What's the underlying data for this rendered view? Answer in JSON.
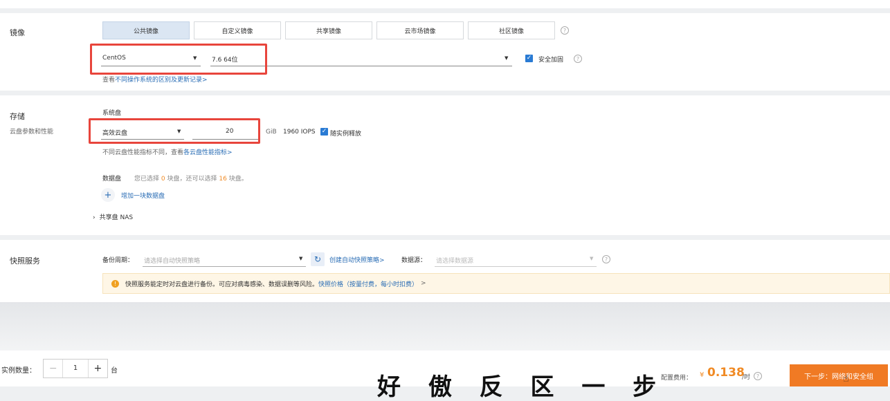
{
  "image": {
    "label": "镜像",
    "tabs": [
      "公共镜像",
      "自定义镜像",
      "共享镜像",
      "云市场镜像",
      "社区镜像"
    ],
    "os": "CentOS",
    "version": "7.6 64位",
    "security_label": "安全加固",
    "hint_prefix": "查看",
    "hint_link": "不同操作系统的区别及更新记录>"
  },
  "storage": {
    "label": "存储",
    "sub_label": "云盘参数和性能",
    "system_disk_label": "系统盘",
    "disk_type": "高效云盘",
    "disk_size": "20",
    "unit": "GiB",
    "iops": "1960 IOPS",
    "release_label": "随实例释放",
    "perf_hint": "不同云盘性能指标不同，查看",
    "perf_link": "各云盘性能指标>",
    "data_disk_label": "数据盘",
    "data_disk_hint_1": "您已选择",
    "data_disk_count": "0",
    "data_disk_hint_2": "块盘，还可以选择",
    "data_disk_remaining": "16",
    "data_disk_hint_3": "块盘。",
    "add_disk_label": "增加一块数据盘",
    "nas_label": "共享盘 NAS"
  },
  "snapshot": {
    "label": "快照服务",
    "period_label": "备份周期：",
    "period_placeholder": "请选择自动快照策略",
    "create_link": "创建自动快照策略>",
    "source_label": "数据源：",
    "source_placeholder": "请选择数据源",
    "notice": "快照服务能定时对云盘进行备份。可应对病毒感染、数据误删等风险。",
    "notice_link": "快照价格（按量付费，每小时扣费）",
    "notice_arrow": ">"
  },
  "footer": {
    "qty_label": "实例数量：",
    "qty_value": "1",
    "qty_unit": "台",
    "cost_label": "配置费用：",
    "currency": "¥",
    "cost_value": "0.138",
    "cost_unit": "/时",
    "next_button": "下一步：网络和安全组"
  },
  "caption": "好 傲 反 区 一 步",
  "colors": {
    "accent": "#2a7bd4",
    "highlight_border": "#e8453c",
    "price": "#f08a24",
    "next_button": "#f07a24"
  }
}
